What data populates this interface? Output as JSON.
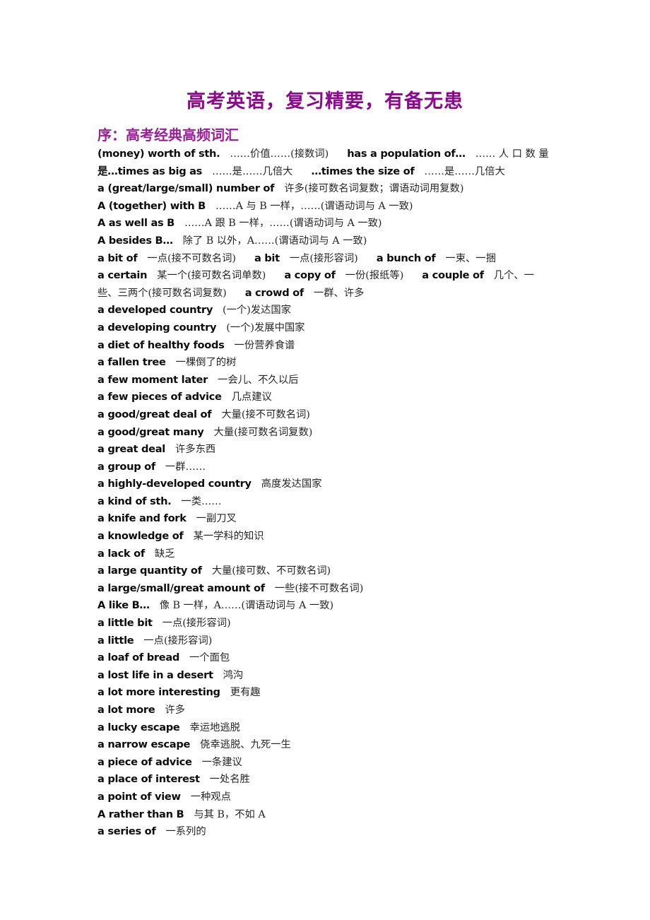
{
  "document": {
    "title": "高考英语，复习精要，有备无患",
    "subtitle": "序：高考经典高频词汇",
    "title_color": "#8B0A8B",
    "subtitle_color": "#9A1F96",
    "body_color": "#1a1a1a",
    "background_color": "#ffffff"
  },
  "entries": [
    {
      "id": 0,
      "en": "(money) worth of sth.",
      "zh": "……价值……(接数词)",
      "en2": "has a population of…",
      "zh2": "…… 人 口 数 量"
    },
    {
      "id": 1,
      "en": "是…times as big as",
      "zh": "……是……几倍大",
      "en2": "…times the size of",
      "zh2": "……是……几倍大"
    },
    {
      "id": 2,
      "en": "a (great/large/small) number of",
      "zh": "许多(接可数名词复数；谓语动词用复数)",
      "en2": "",
      "zh2": ""
    },
    {
      "id": 3,
      "en": "A (together) with B",
      "zh": "……A 与 B 一样，……(谓语动词与 A 一致)",
      "en2": "",
      "zh2": ""
    },
    {
      "id": 4,
      "en": "A as well as B",
      "zh": "……A 跟 B 一样，……(谓语动词与 A 一致)",
      "en2": "",
      "zh2": ""
    },
    {
      "id": 5,
      "en": "A besides B…",
      "zh": "除了 B 以外，A……(谓语动词与 A 一致)",
      "en2": "",
      "zh2": ""
    },
    {
      "id": 6,
      "en": "a bit of",
      "zh": "一点(接不可数名词)",
      "en2": "a bit",
      "zh2": "一点(接形容词)",
      "en3": "a bunch of",
      "zh3": "一束、一捆"
    },
    {
      "id": 7,
      "en": "a certain",
      "zh": "某一个(接可数名词单数)",
      "en2": "a copy of",
      "zh2": "一份(报纸等)",
      "en3": "a couple of",
      "zh3": "几个、一"
    },
    {
      "id": 8,
      "en": "",
      "zh": "些、三两个(接可数名词复数)",
      "en2": "a crowd of",
      "zh2": "一群、许多"
    },
    {
      "id": 9,
      "en": "a developed country",
      "zh": "(一个)发达国家",
      "en2": "",
      "zh2": ""
    },
    {
      "id": 10,
      "en": "a developing country",
      "zh": "(一个)发展中国家",
      "en2": "",
      "zh2": ""
    },
    {
      "id": 11,
      "en": "a diet of healthy foods",
      "zh": "一份营养食谱",
      "en2": "",
      "zh2": ""
    },
    {
      "id": 12,
      "en": "a fallen tree",
      "zh": "一棵倒了的树",
      "en2": "",
      "zh2": ""
    },
    {
      "id": 13,
      "en": "a few moment later",
      "zh": "一会儿、不久以后",
      "en2": "",
      "zh2": ""
    },
    {
      "id": 14,
      "en": "a few pieces of advice",
      "zh": "几点建议",
      "en2": "",
      "zh2": ""
    },
    {
      "id": 15,
      "en": "a good/great deal of",
      "zh": "大量(接不可数名词)",
      "en2": "",
      "zh2": ""
    },
    {
      "id": 16,
      "en": "a good/great many",
      "zh": "大量(接可数名词复数)",
      "en2": "",
      "zh2": ""
    },
    {
      "id": 17,
      "en": "a great deal",
      "zh": "许多东西",
      "en2": "",
      "zh2": ""
    },
    {
      "id": 18,
      "en": "a group of",
      "zh": "一群……",
      "en2": "",
      "zh2": ""
    },
    {
      "id": 19,
      "en": "a highly-developed country",
      "zh": "高度发达国家",
      "en2": "",
      "zh2": ""
    },
    {
      "id": 20,
      "en": "a kind of sth.",
      "zh": "一类……",
      "en2": "",
      "zh2": ""
    },
    {
      "id": 21,
      "en": "a knife and fork",
      "zh": "一副刀叉",
      "en2": "",
      "zh2": ""
    },
    {
      "id": 22,
      "en": "a knowledge of",
      "zh": "某一学科的知识",
      "en2": "",
      "zh2": ""
    },
    {
      "id": 23,
      "en": "a lack of",
      "zh": "缺乏",
      "en2": "",
      "zh2": ""
    },
    {
      "id": 24,
      "en": "a large quantity of",
      "zh": "大量(接可数、不可数名词)",
      "en2": "",
      "zh2": ""
    },
    {
      "id": 25,
      "en": "a large/small/great amount of",
      "zh": "一些(接不可数名词)",
      "en2": "",
      "zh2": ""
    },
    {
      "id": 26,
      "en": "A like B…",
      "zh": "像 B 一样，A……(谓语动词与 A 一致)",
      "en2": "",
      "zh2": ""
    },
    {
      "id": 27,
      "en": "a little bit",
      "zh": "一点(接形容词)",
      "en2": "",
      "zh2": ""
    },
    {
      "id": 28,
      "en": "a little",
      "zh": "一点(接形容词)",
      "en2": "",
      "zh2": ""
    },
    {
      "id": 29,
      "en": "a loaf of bread",
      "zh": "一个面包",
      "en2": "",
      "zh2": ""
    },
    {
      "id": 30,
      "en": "a lost life in a desert",
      "zh": "鸿沟",
      "en2": "",
      "zh2": ""
    },
    {
      "id": 31,
      "en": "a lot more interesting",
      "zh": "更有趣",
      "en2": "",
      "zh2": ""
    },
    {
      "id": 32,
      "en": "a lot more",
      "zh": "许多",
      "en2": "",
      "zh2": ""
    },
    {
      "id": 33,
      "en": "a lucky escape",
      "zh": "幸运地逃脱",
      "en2": "",
      "zh2": ""
    },
    {
      "id": 34,
      "en": "a narrow escape",
      "zh": "侥幸逃脱、九死一生",
      "en2": "",
      "zh2": ""
    },
    {
      "id": 35,
      "en": "a piece of advice",
      "zh": "一条建议",
      "en2": "",
      "zh2": ""
    },
    {
      "id": 36,
      "en": "a place of interest",
      "zh": "一处名胜",
      "en2": "",
      "zh2": ""
    },
    {
      "id": 37,
      "en": "a point of view",
      "zh": "一种观点",
      "en2": "",
      "zh2": ""
    },
    {
      "id": 38,
      "en": "A rather than B",
      "zh": "与其 B，不如 A",
      "en2": "",
      "zh2": ""
    },
    {
      "id": 39,
      "en": "a series of",
      "zh": "一系列的",
      "en2": "",
      "zh2": ""
    }
  ]
}
